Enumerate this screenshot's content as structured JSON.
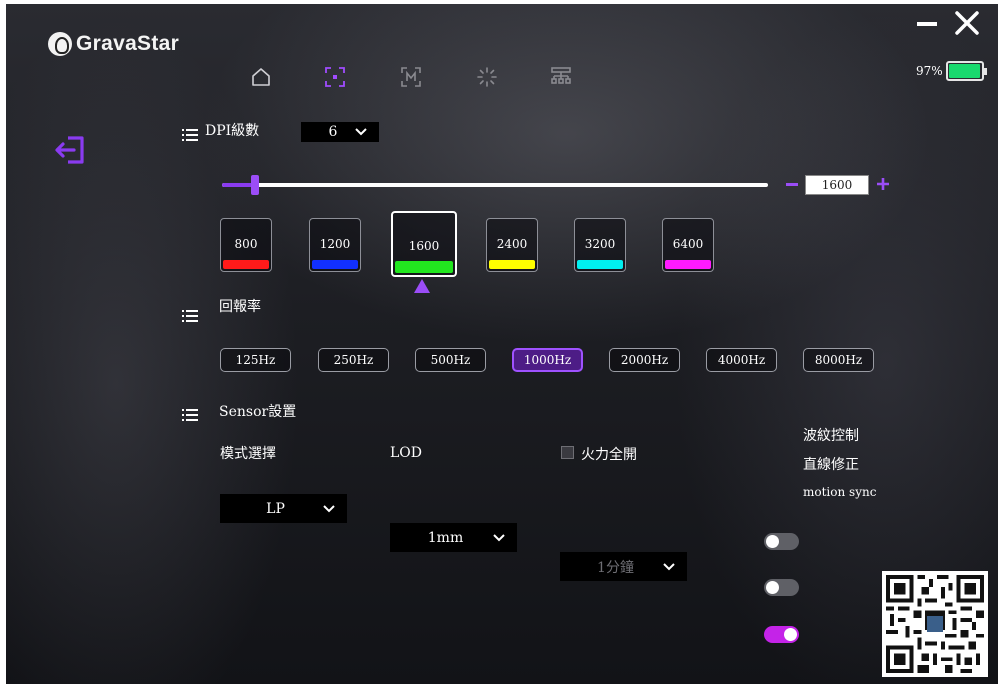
{
  "app": {
    "brand": "GravaStar"
  },
  "battery": {
    "percent_label": "97%",
    "level": 0.97,
    "color": "#19d96e"
  },
  "accent_color": "#9b4df7",
  "nav": {
    "items": [
      {
        "icon": "home-icon"
      },
      {
        "icon": "dpi-target-icon",
        "active": true
      },
      {
        "icon": "macro-icon"
      },
      {
        "icon": "lighting-icon"
      },
      {
        "icon": "network-icon"
      }
    ]
  },
  "dpi": {
    "title": "DPI級數",
    "stage_count": "6",
    "value": "1600",
    "slider_fraction": 0.06,
    "stages": [
      {
        "label": "800",
        "color": "#ff1a1a"
      },
      {
        "label": "1200",
        "color": "#1230ff"
      },
      {
        "label": "1600",
        "color": "#22e61f",
        "active": true
      },
      {
        "label": "2400",
        "color": "#ffff00"
      },
      {
        "label": "3200",
        "color": "#00f0f0"
      },
      {
        "label": "6400",
        "color": "#ff1aff"
      }
    ]
  },
  "polling": {
    "title": "回報率",
    "rates": [
      "125Hz",
      "250Hz",
      "500Hz",
      "1000Hz",
      "2000Hz",
      "4000Hz",
      "8000Hz"
    ],
    "selected": "1000Hz"
  },
  "sensor": {
    "title": "Sensor設置",
    "mode_label": "模式選擇",
    "mode_value": "LP",
    "lod_label": "LOD",
    "lod_value": "1mm",
    "fire_label": "火力全開",
    "fire_value": "1分鐘",
    "toggles": [
      {
        "label": "波紋控制",
        "on": false
      },
      {
        "label": "直線修正",
        "on": false
      },
      {
        "label": "motion sync",
        "on": true
      }
    ]
  }
}
